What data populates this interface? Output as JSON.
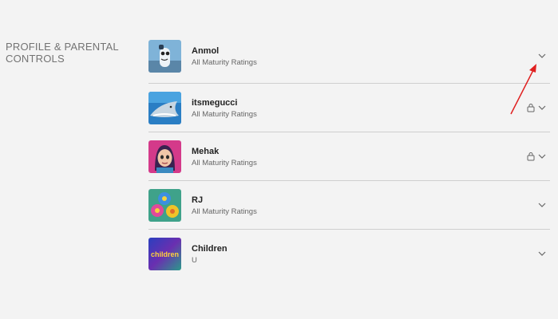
{
  "section": {
    "title_line1": "PROFILE & PARENTAL",
    "title_line2": "CONTROLS"
  },
  "profiles": [
    {
      "name": "Anmol",
      "rating": "All Maturity Ratings",
      "locked": false,
      "avatar_icon": "robot-avatar-icon"
    },
    {
      "name": "itsmegucci",
      "rating": "All Maturity Ratings",
      "locked": true,
      "avatar_icon": "shark-avatar-icon"
    },
    {
      "name": "Mehak",
      "rating": "All Maturity Ratings",
      "locked": true,
      "avatar_icon": "girl-avatar-icon"
    },
    {
      "name": "RJ",
      "rating": "All Maturity Ratings",
      "locked": false,
      "avatar_icon": "flowers-avatar-icon"
    },
    {
      "name": "Children",
      "rating": "U",
      "locked": false,
      "avatar_icon": "children-avatar-icon"
    }
  ],
  "children_logo_text": "children",
  "annotation_color": "#e02020"
}
